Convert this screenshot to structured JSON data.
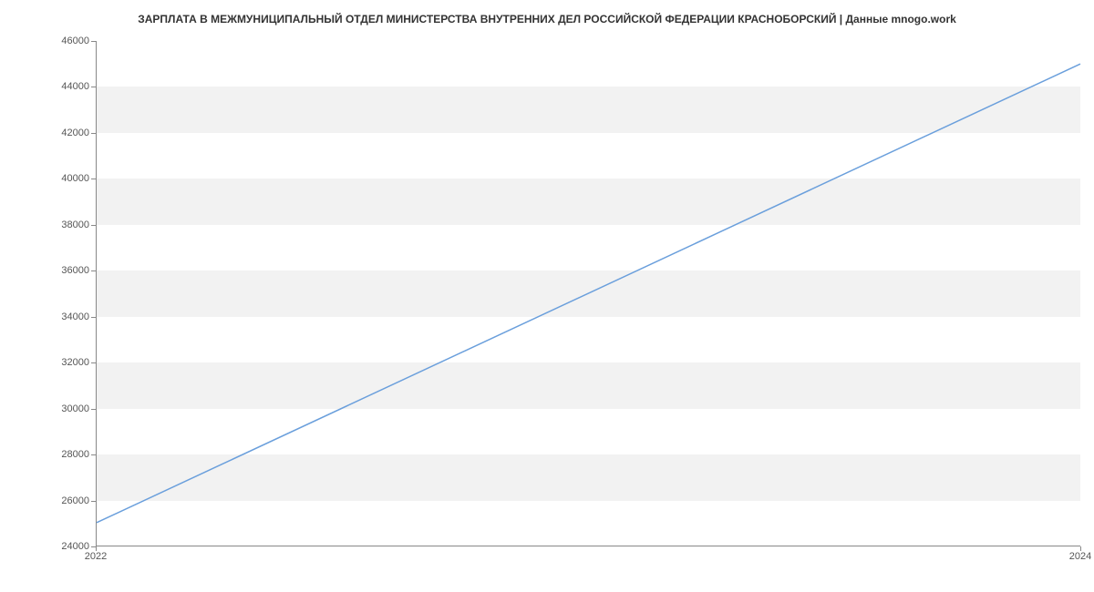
{
  "chart_data": {
    "type": "line",
    "title": "ЗАРПЛАТА В МЕЖМУНИЦИПАЛЬНЫЙ ОТДЕЛ МИНИСТЕРСТВА ВНУТРЕННИХ ДЕЛ РОССИЙСКОЙ ФЕДЕРАЦИИ КРАСНОБОРСКИЙ | Данные mnogo.work",
    "x": [
      2022,
      2024
    ],
    "values": [
      25000,
      45000
    ],
    "xlabel": "",
    "ylabel": "",
    "xlim": [
      2022,
      2024
    ],
    "ylim": [
      24000,
      46000
    ],
    "x_ticks": [
      2022,
      2024
    ],
    "y_ticks": [
      24000,
      26000,
      28000,
      30000,
      32000,
      34000,
      36000,
      38000,
      40000,
      42000,
      44000,
      46000
    ],
    "line_color": "#6a9fdc",
    "band_color": "#f2f2f2"
  }
}
